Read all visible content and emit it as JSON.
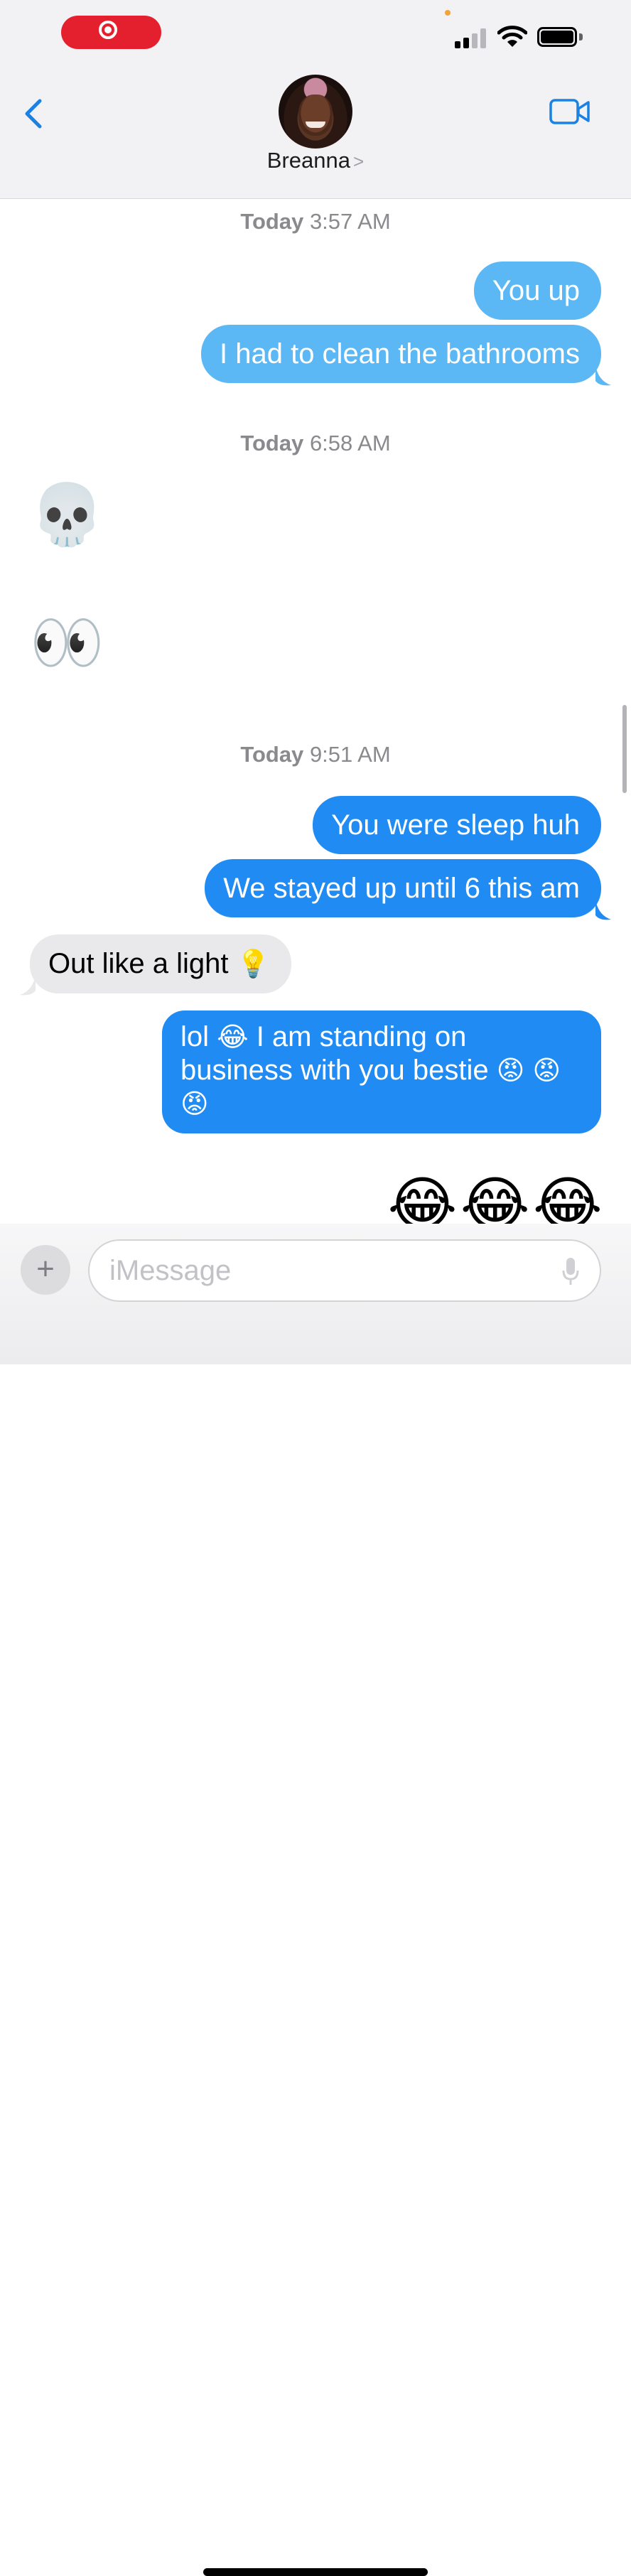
{
  "status_bar": {
    "recording_indicator": "record-icon",
    "signal": "cellular-signal-icon",
    "wifi": "wifi-icon",
    "battery": "battery-icon"
  },
  "header": {
    "back_icon": "chevron-left-icon",
    "contact_name": "Breanna",
    "contact_chevron": ">",
    "video_icon": "video-camera-icon",
    "accent_color": "#1a82e2"
  },
  "conversation": {
    "sections": [
      {
        "day": "Today",
        "time": "3:57 AM"
      },
      {
        "day": "Today",
        "time": "6:58 AM"
      },
      {
        "day": "Today",
        "time": "9:51 AM"
      }
    ],
    "messages": [
      {
        "from": "me",
        "text": "You up"
      },
      {
        "from": "me",
        "text": "I had to clean the bathrooms"
      },
      {
        "from": "them",
        "text": "💀"
      },
      {
        "from": "them",
        "text": "👀"
      },
      {
        "from": "me",
        "text": "You were sleep huh"
      },
      {
        "from": "me",
        "text": "We stayed  up until 6 this am"
      },
      {
        "from": "them",
        "text": "Out like a light",
        "emoji": "💡"
      },
      {
        "from": "me",
        "text_a": "lol",
        "emoji_a": "😂",
        "text_b": "I am standing on business with you bestie",
        "emoji_b": "😡",
        "emoji_c": "😡",
        "emoji_d": "😡"
      },
      {
        "from": "me",
        "text": "😂😂😂"
      }
    ]
  },
  "input": {
    "plus_label": "+",
    "placeholder": "iMessage",
    "mic_icon": "microphone-icon"
  },
  "colors": {
    "sent_bubble": "#1f8bf3",
    "sent_bubble_faded": "#5bb8f5",
    "received_bubble": "#e9e9eb",
    "record_pill": "#e5202e"
  }
}
